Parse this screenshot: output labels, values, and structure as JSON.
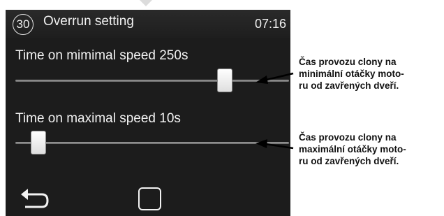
{
  "header": {
    "badge": "30",
    "title": "Overrun setting",
    "time": "07:16"
  },
  "settings": [
    {
      "label": "Time on mimimal speed 250s",
      "level": 0.78
    },
    {
      "label": "Time on maximal speed 10s",
      "level": 0.06
    }
  ],
  "annotations": [
    "Čas provozu clony na\nminimální otáčky moto-\nru od zavřených dveří.",
    "Čas provozu clony na\nmaximální otáčky moto-\nru od zavřených dveří."
  ],
  "icons": {
    "back": "back-arrow-icon",
    "ok": "square-icon"
  },
  "colors": {
    "screen_bg": "#1c1c1c",
    "text": "#f0f0f0",
    "annotation_text": "#111111"
  }
}
